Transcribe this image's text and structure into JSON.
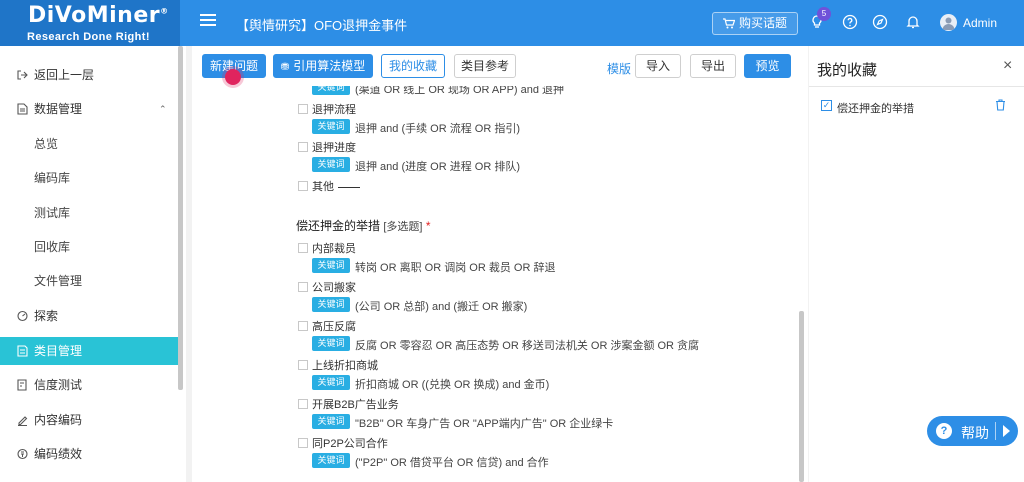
{
  "header": {
    "logo_main": "DiVoMiner",
    "logo_mark": "®",
    "logo_sub": "Research Done Right!",
    "project_title": "【舆情研究】OFO退押金事件",
    "buy_label": "购买话题",
    "notification_count": "5",
    "user_name": "Admin"
  },
  "sidebar": {
    "items": [
      {
        "label": "返回上一层",
        "icon": "back-icon"
      },
      {
        "label": "数据管理",
        "icon": "file-icon"
      },
      {
        "label": "总览"
      },
      {
        "label": "编码库"
      },
      {
        "label": "测试库"
      },
      {
        "label": "回收库"
      },
      {
        "label": "文件管理"
      },
      {
        "label": "探索",
        "icon": "explore-icon"
      },
      {
        "label": "类目管理",
        "icon": "category-icon"
      },
      {
        "label": "信度测试",
        "icon": "test-icon"
      },
      {
        "label": "内容编码",
        "icon": "edit-icon"
      },
      {
        "label": "编码绩效",
        "icon": "performance-icon"
      }
    ]
  },
  "toolbar": {
    "new_question": "新建问题",
    "algorithm_model": "引用算法模型",
    "my_favorites": "我的收藏",
    "category_reference": "类目参考",
    "template": "模版",
    "import": "导入",
    "export": "导出",
    "preview": "预览"
  },
  "content": {
    "keyword_tag": "关键词",
    "partial_top": "(渠道 OR 线上 OR 现场 OR APP) and 退押",
    "options_top": [
      {
        "label": "退押流程",
        "expr": "退押 and (手续 OR 流程 OR 指引)"
      },
      {
        "label": "退押进度",
        "expr": "退押 and (进度 OR 进程 OR 排队)"
      }
    ],
    "other_label": "其他",
    "question_title": "偿还押金的举措",
    "question_type": "[多选题]",
    "required_mark": "*",
    "options": [
      {
        "label": "内部裁员",
        "expr": "转岗 OR 离职 OR 调岗 OR 裁员 OR 辞退"
      },
      {
        "label": "公司搬家",
        "expr": "(公司 OR 总部) and (搬迁 OR 搬家)"
      },
      {
        "label": "高压反腐",
        "expr": "反腐 OR 零容忍 OR 高压态势 OR 移送司法机关 OR 涉案金额 OR 贪腐"
      },
      {
        "label": "上线折扣商城",
        "expr": "折扣商城 OR ((兑换 OR 换成) and 金币)"
      },
      {
        "label": "开展B2B广告业务",
        "expr": "\"B2B\" OR 车身广告 OR \"APP端内广告\" OR 企业绿卡"
      },
      {
        "label": "同P2P公司合作",
        "expr": "(\"P2P\" OR 借贷平台 OR 信贷) and 合作"
      }
    ]
  },
  "favorites": {
    "title": "我的收藏",
    "close": "×",
    "item": "偿还押金的举措"
  },
  "help": {
    "label": "帮助",
    "q": "?"
  },
  "colors": {
    "primary": "#2d8ee6",
    "active": "#29c3d6",
    "keyword": "#29aee3"
  }
}
